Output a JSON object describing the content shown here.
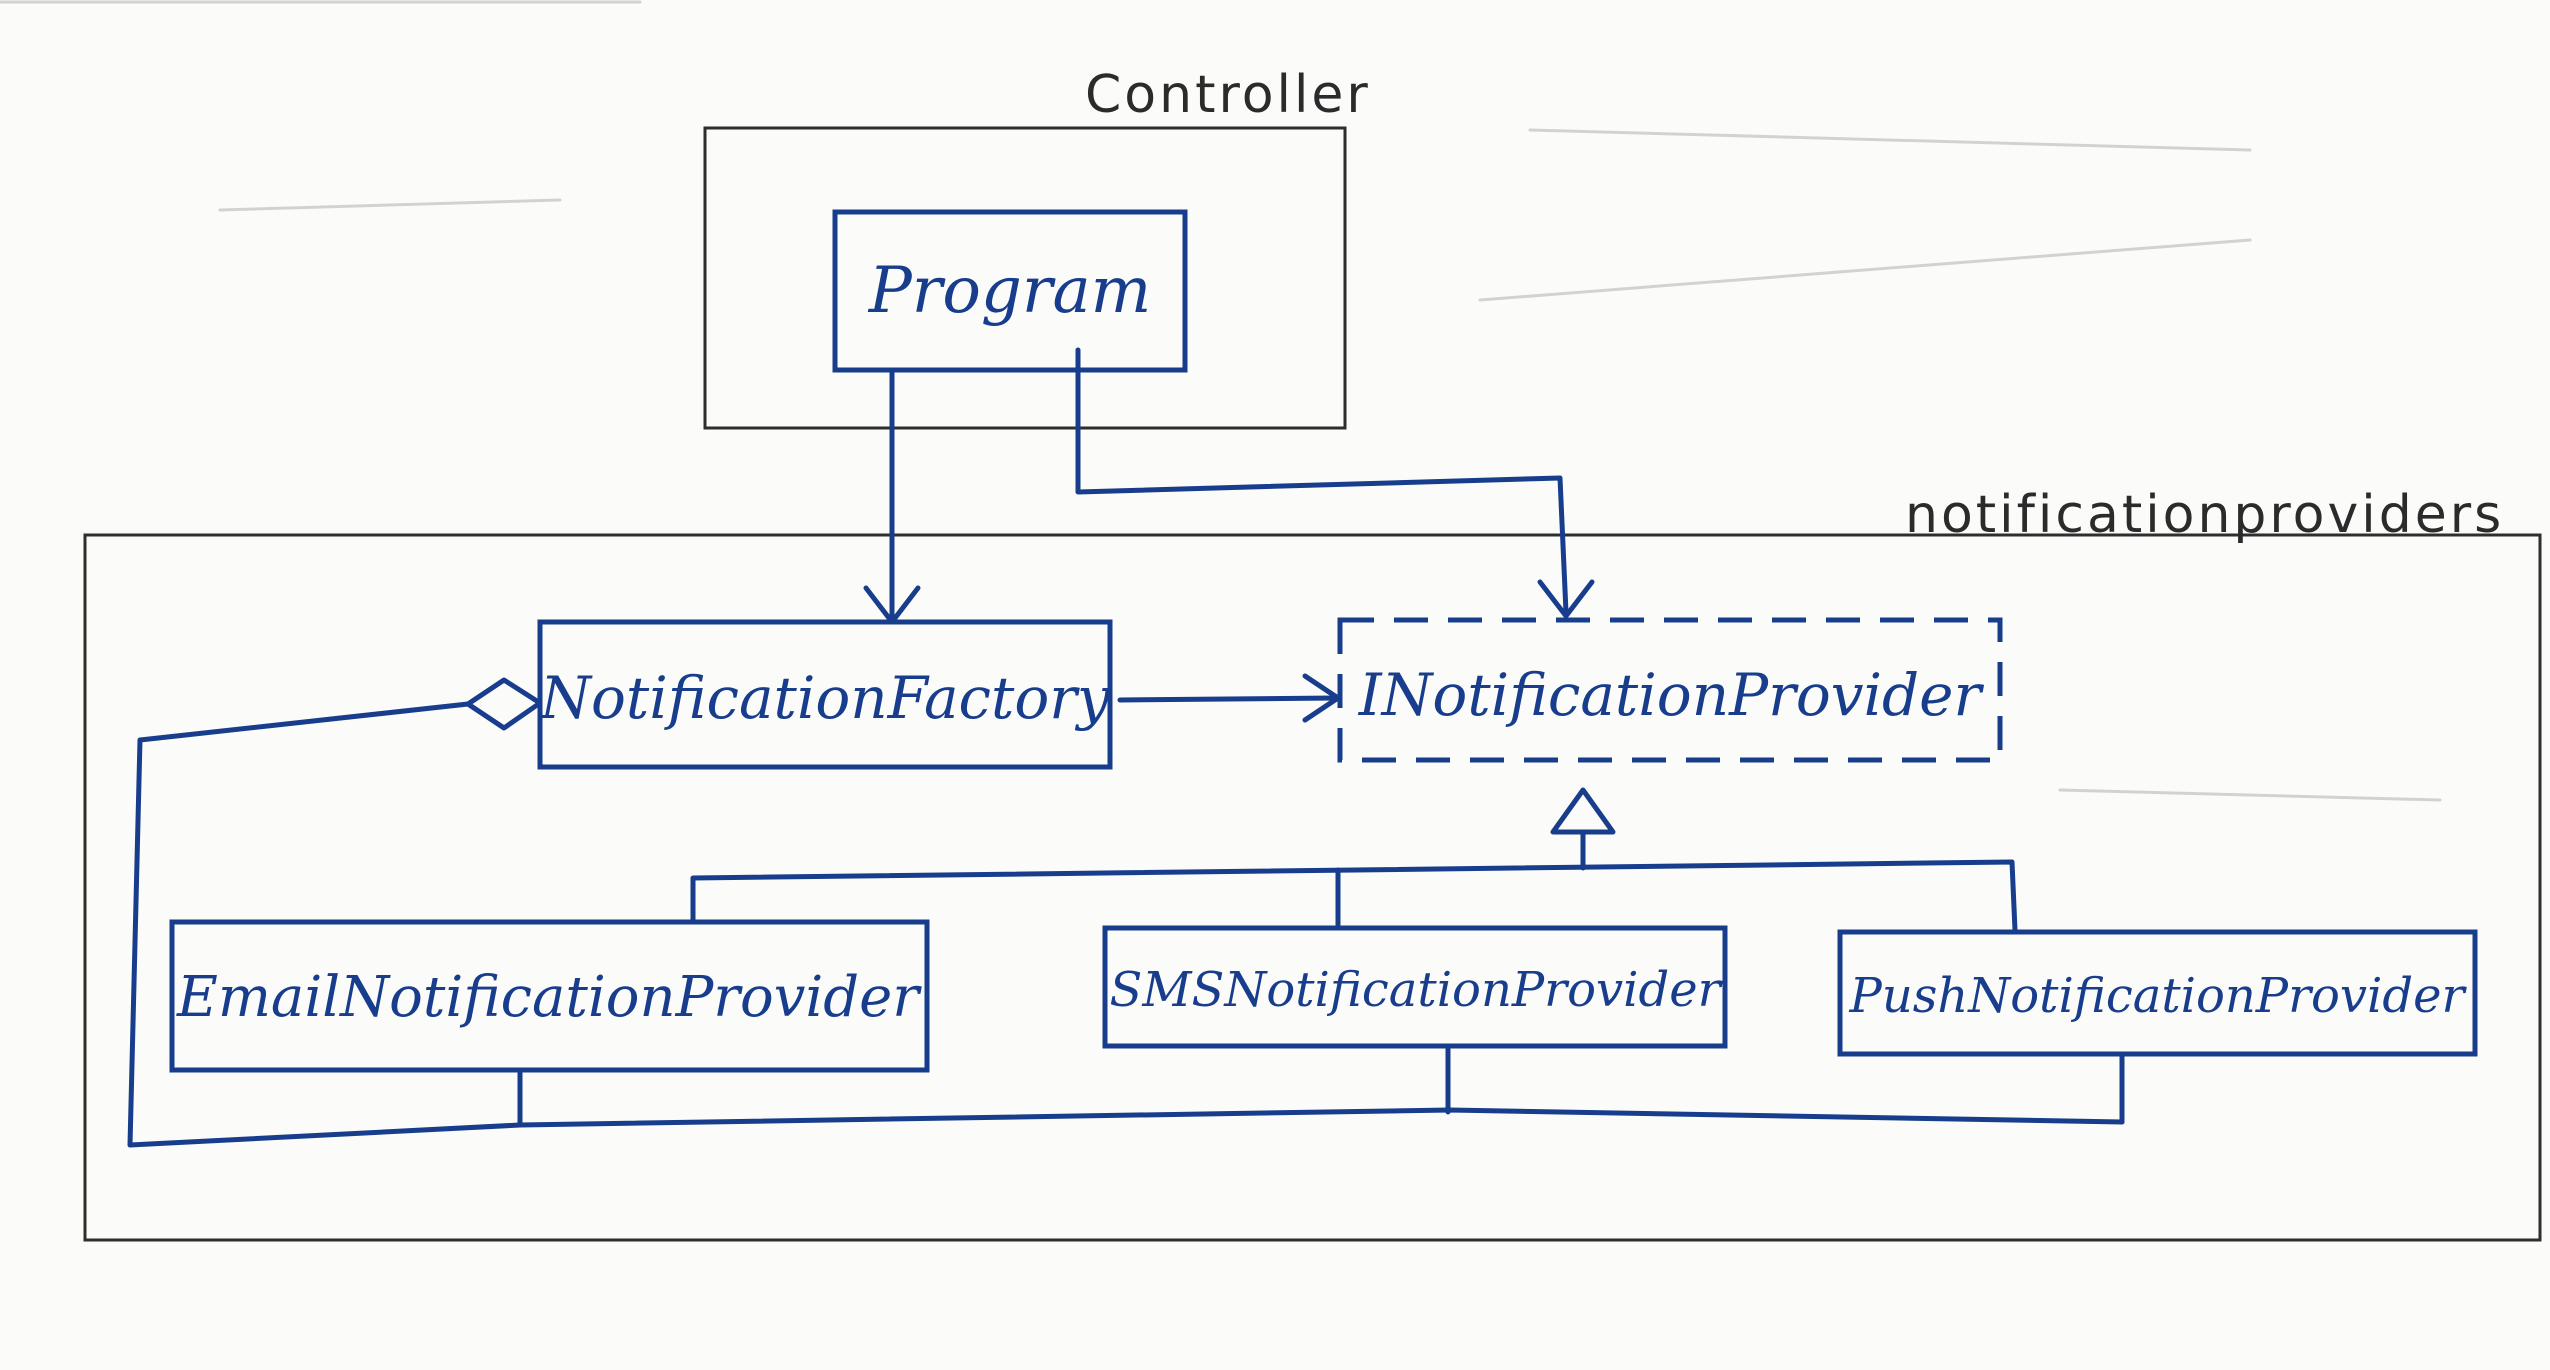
{
  "diagram": {
    "packages": {
      "controller": {
        "label": "Controller"
      },
      "notificationproviders": {
        "label": "notificationproviders"
      }
    },
    "classes": {
      "program": {
        "label": "Program"
      },
      "notification_factory": {
        "label": "NotificationFactory"
      },
      "inotification_provider": {
        "label": "INotificationProvider",
        "kind": "interface"
      },
      "email_provider": {
        "label": "EmailNotificationProvider"
      },
      "sms_provider": {
        "label": "SMSNotificationProvider"
      },
      "push_provider": {
        "label": "PushNotificationProvider"
      }
    },
    "relationships": [
      {
        "from": "Program",
        "to": "NotificationFactory",
        "type": "dependency-arrow"
      },
      {
        "from": "Program",
        "to": "INotificationProvider",
        "type": "dependency-arrow"
      },
      {
        "from": "NotificationFactory",
        "to": "INotificationProvider",
        "type": "dependency-arrow"
      },
      {
        "from": "EmailNotificationProvider",
        "to": "INotificationProvider",
        "type": "realization"
      },
      {
        "from": "SMSNotificationProvider",
        "to": "INotificationProvider",
        "type": "realization"
      },
      {
        "from": "PushNotificationProvider",
        "to": "INotificationProvider",
        "type": "realization"
      },
      {
        "from": "NotificationFactory",
        "to": "EmailNotificationProvider, SMSNotificationProvider, PushNotificationProvider",
        "type": "aggregation"
      }
    ],
    "colors": {
      "ink": "#173d8c",
      "pencil": "#2e2e2e",
      "paper": "#fbfbf9"
    }
  }
}
